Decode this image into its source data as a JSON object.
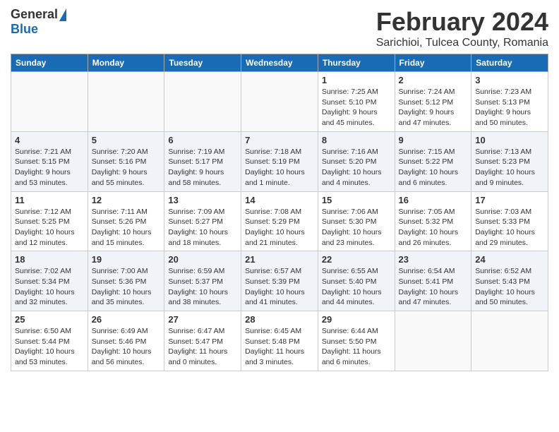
{
  "header": {
    "logo_general": "General",
    "logo_blue": "Blue",
    "month_title": "February 2024",
    "location": "Sarichioi, Tulcea County, Romania"
  },
  "days_of_week": [
    "Sunday",
    "Monday",
    "Tuesday",
    "Wednesday",
    "Thursday",
    "Friday",
    "Saturday"
  ],
  "weeks": [
    [
      {
        "day": "",
        "info": ""
      },
      {
        "day": "",
        "info": ""
      },
      {
        "day": "",
        "info": ""
      },
      {
        "day": "",
        "info": ""
      },
      {
        "day": "1",
        "info": "Sunrise: 7:25 AM\nSunset: 5:10 PM\nDaylight: 9 hours\nand 45 minutes."
      },
      {
        "day": "2",
        "info": "Sunrise: 7:24 AM\nSunset: 5:12 PM\nDaylight: 9 hours\nand 47 minutes."
      },
      {
        "day": "3",
        "info": "Sunrise: 7:23 AM\nSunset: 5:13 PM\nDaylight: 9 hours\nand 50 minutes."
      }
    ],
    [
      {
        "day": "4",
        "info": "Sunrise: 7:21 AM\nSunset: 5:15 PM\nDaylight: 9 hours\nand 53 minutes."
      },
      {
        "day": "5",
        "info": "Sunrise: 7:20 AM\nSunset: 5:16 PM\nDaylight: 9 hours\nand 55 minutes."
      },
      {
        "day": "6",
        "info": "Sunrise: 7:19 AM\nSunset: 5:17 PM\nDaylight: 9 hours\nand 58 minutes."
      },
      {
        "day": "7",
        "info": "Sunrise: 7:18 AM\nSunset: 5:19 PM\nDaylight: 10 hours\nand 1 minute."
      },
      {
        "day": "8",
        "info": "Sunrise: 7:16 AM\nSunset: 5:20 PM\nDaylight: 10 hours\nand 4 minutes."
      },
      {
        "day": "9",
        "info": "Sunrise: 7:15 AM\nSunset: 5:22 PM\nDaylight: 10 hours\nand 6 minutes."
      },
      {
        "day": "10",
        "info": "Sunrise: 7:13 AM\nSunset: 5:23 PM\nDaylight: 10 hours\nand 9 minutes."
      }
    ],
    [
      {
        "day": "11",
        "info": "Sunrise: 7:12 AM\nSunset: 5:25 PM\nDaylight: 10 hours\nand 12 minutes."
      },
      {
        "day": "12",
        "info": "Sunrise: 7:11 AM\nSunset: 5:26 PM\nDaylight: 10 hours\nand 15 minutes."
      },
      {
        "day": "13",
        "info": "Sunrise: 7:09 AM\nSunset: 5:27 PM\nDaylight: 10 hours\nand 18 minutes."
      },
      {
        "day": "14",
        "info": "Sunrise: 7:08 AM\nSunset: 5:29 PM\nDaylight: 10 hours\nand 21 minutes."
      },
      {
        "day": "15",
        "info": "Sunrise: 7:06 AM\nSunset: 5:30 PM\nDaylight: 10 hours\nand 23 minutes."
      },
      {
        "day": "16",
        "info": "Sunrise: 7:05 AM\nSunset: 5:32 PM\nDaylight: 10 hours\nand 26 minutes."
      },
      {
        "day": "17",
        "info": "Sunrise: 7:03 AM\nSunset: 5:33 PM\nDaylight: 10 hours\nand 29 minutes."
      }
    ],
    [
      {
        "day": "18",
        "info": "Sunrise: 7:02 AM\nSunset: 5:34 PM\nDaylight: 10 hours\nand 32 minutes."
      },
      {
        "day": "19",
        "info": "Sunrise: 7:00 AM\nSunset: 5:36 PM\nDaylight: 10 hours\nand 35 minutes."
      },
      {
        "day": "20",
        "info": "Sunrise: 6:59 AM\nSunset: 5:37 PM\nDaylight: 10 hours\nand 38 minutes."
      },
      {
        "day": "21",
        "info": "Sunrise: 6:57 AM\nSunset: 5:39 PM\nDaylight: 10 hours\nand 41 minutes."
      },
      {
        "day": "22",
        "info": "Sunrise: 6:55 AM\nSunset: 5:40 PM\nDaylight: 10 hours\nand 44 minutes."
      },
      {
        "day": "23",
        "info": "Sunrise: 6:54 AM\nSunset: 5:41 PM\nDaylight: 10 hours\nand 47 minutes."
      },
      {
        "day": "24",
        "info": "Sunrise: 6:52 AM\nSunset: 5:43 PM\nDaylight: 10 hours\nand 50 minutes."
      }
    ],
    [
      {
        "day": "25",
        "info": "Sunrise: 6:50 AM\nSunset: 5:44 PM\nDaylight: 10 hours\nand 53 minutes."
      },
      {
        "day": "26",
        "info": "Sunrise: 6:49 AM\nSunset: 5:46 PM\nDaylight: 10 hours\nand 56 minutes."
      },
      {
        "day": "27",
        "info": "Sunrise: 6:47 AM\nSunset: 5:47 PM\nDaylight: 11 hours\nand 0 minutes."
      },
      {
        "day": "28",
        "info": "Sunrise: 6:45 AM\nSunset: 5:48 PM\nDaylight: 11 hours\nand 3 minutes."
      },
      {
        "day": "29",
        "info": "Sunrise: 6:44 AM\nSunset: 5:50 PM\nDaylight: 11 hours\nand 6 minutes."
      },
      {
        "day": "",
        "info": ""
      },
      {
        "day": "",
        "info": ""
      }
    ]
  ]
}
